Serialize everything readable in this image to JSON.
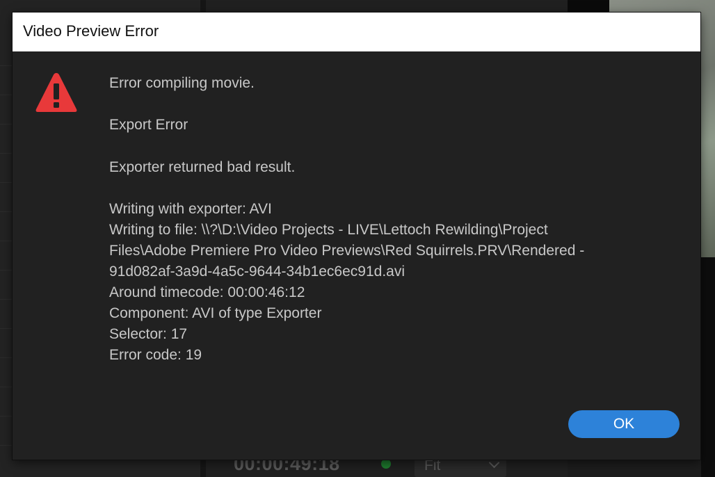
{
  "dialog": {
    "title": "Video Preview Error",
    "icon": "warning-triangle-icon",
    "messages": [
      "Error compiling movie.",
      "Export Error",
      "Exporter returned bad result.",
      "Writing with exporter: AVI",
      "Writing to file: \\\\?\\D:\\Video Projects - LIVE\\Lettoch Rewilding\\Project",
      "Files\\Adobe Premiere Pro Video Previews\\Red Squirrels.PRV\\Rendered -",
      "91d082af-3a9d-4a5c-9644-34b1ec6ec91d.avi",
      "Around timecode: 00:00:46:12",
      "Component: AVI of type Exporter",
      "Selector: 17",
      "Error code: 19"
    ],
    "ok_label": "OK"
  },
  "background": {
    "timecode": "00:00:49:18",
    "fit_label": "Fit"
  },
  "colors": {
    "accent": "#2d82d9",
    "warning": "#e8393a",
    "dialog_bg": "#212121",
    "text": "#c8c8c8"
  }
}
